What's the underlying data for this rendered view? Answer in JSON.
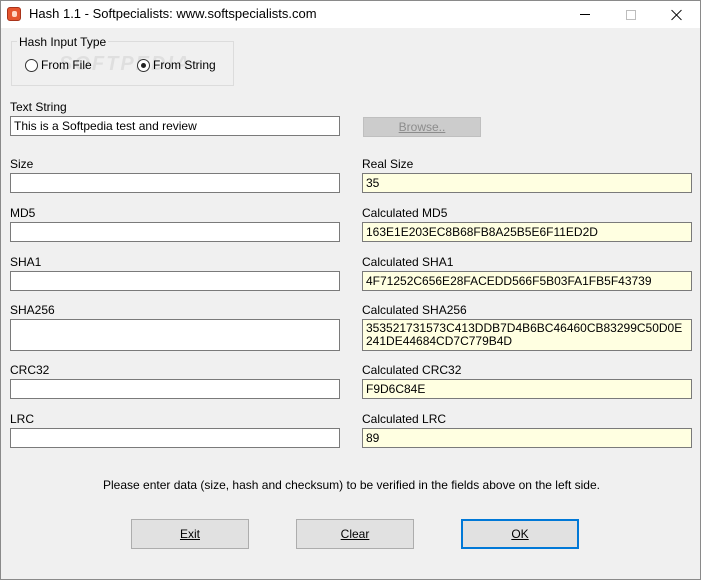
{
  "window": {
    "title": "Hash 1.1 - Softpecialists: www.softspecialists.com"
  },
  "hash_input_type": {
    "legend": "Hash Input Type",
    "options": [
      {
        "label": "From File",
        "checked": false
      },
      {
        "label": "From String",
        "checked": true
      }
    ]
  },
  "watermark": "SOFTPEDIA",
  "text_string": {
    "label": "Text String",
    "value": "This is a Softpedia test and review",
    "browse_label": "Browse.."
  },
  "left_fields": [
    {
      "label": "Size",
      "value": ""
    },
    {
      "label": "MD5",
      "value": ""
    },
    {
      "label": "SHA1",
      "value": ""
    },
    {
      "label": "SHA256",
      "value": ""
    },
    {
      "label": "CRC32",
      "value": ""
    },
    {
      "label": "LRC",
      "value": ""
    }
  ],
  "right_fields": [
    {
      "label": "Real Size",
      "value": "35"
    },
    {
      "label": "Calculated MD5",
      "value": "163E1E203EC8B68FB8A25B5E6F11ED2D"
    },
    {
      "label": "Calculated SHA1",
      "value": "4F71252C656E28FACEDD566F5B03FA1FB5F43739"
    },
    {
      "label": "Calculated SHA256",
      "value": "353521731573C413DDB7D4B6BC46460CB83299C50D0E241DE44684CD7C779B4D"
    },
    {
      "label": "Calculated CRC32",
      "value": "F9D6C84E"
    },
    {
      "label": "Calculated LRC",
      "value": "89"
    }
  ],
  "info_text": "Please enter data (size, hash and checksum) to be verified in the fields above on the left side.",
  "buttons": {
    "exit": "Exit",
    "clear": "Clear",
    "ok": "OK"
  },
  "colors": {
    "readonly_field_bg": "#ffffe1",
    "default_button_border": "#0078d7"
  }
}
